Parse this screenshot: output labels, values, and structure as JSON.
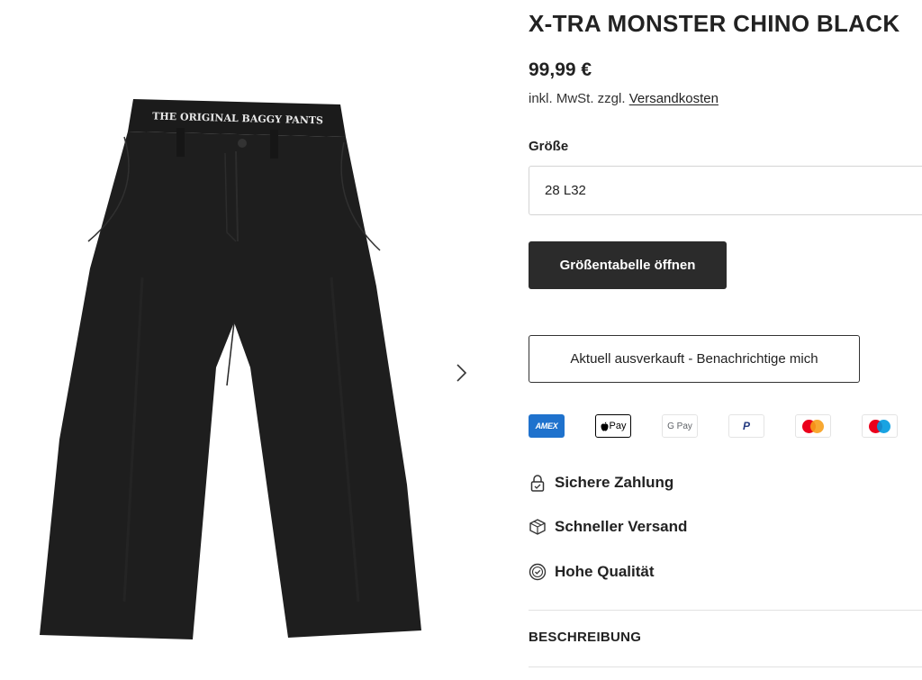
{
  "product": {
    "title": "X-TRA MONSTER CHINO BLACK",
    "price": "99,99 €",
    "tax_note": "inkl. MwSt. zzgl.",
    "shipping_link": "Versandkosten",
    "waistband_text": "THE ORIGINAL BAGGY PANTS"
  },
  "size": {
    "label": "Größe",
    "selected": "28 L32"
  },
  "buttons": {
    "size_chart": "Größentabelle öffnen",
    "notify": "Aktuell ausverkauft - Benachrichtige mich"
  },
  "payment_methods": [
    {
      "name": "american-express-icon",
      "label": "AMEX",
      "color": "#1f72cd"
    },
    {
      "name": "apple-pay-icon",
      "label": "Pay"
    },
    {
      "name": "google-pay-icon",
      "label": "G Pay"
    },
    {
      "name": "paypal-icon",
      "label": "P",
      "color": "#253b80"
    },
    {
      "name": "mastercard-icon",
      "colors": [
        "#eb001b",
        "#f79e1b"
      ]
    },
    {
      "name": "maestro-icon",
      "colors": [
        "#eb001b",
        "#0099df"
      ]
    }
  ],
  "features": [
    {
      "icon": "lock-icon",
      "label": "Sichere Zahlung"
    },
    {
      "icon": "box-icon",
      "label": "Schneller Versand"
    },
    {
      "icon": "quality-badge-icon",
      "label": "Hohe Qualität"
    }
  ],
  "description": {
    "heading": "BESCHREIBUNG"
  },
  "colors": {
    "button_dark": "#2b2b2b",
    "text": "#222222",
    "border": "#d4d4d4"
  }
}
